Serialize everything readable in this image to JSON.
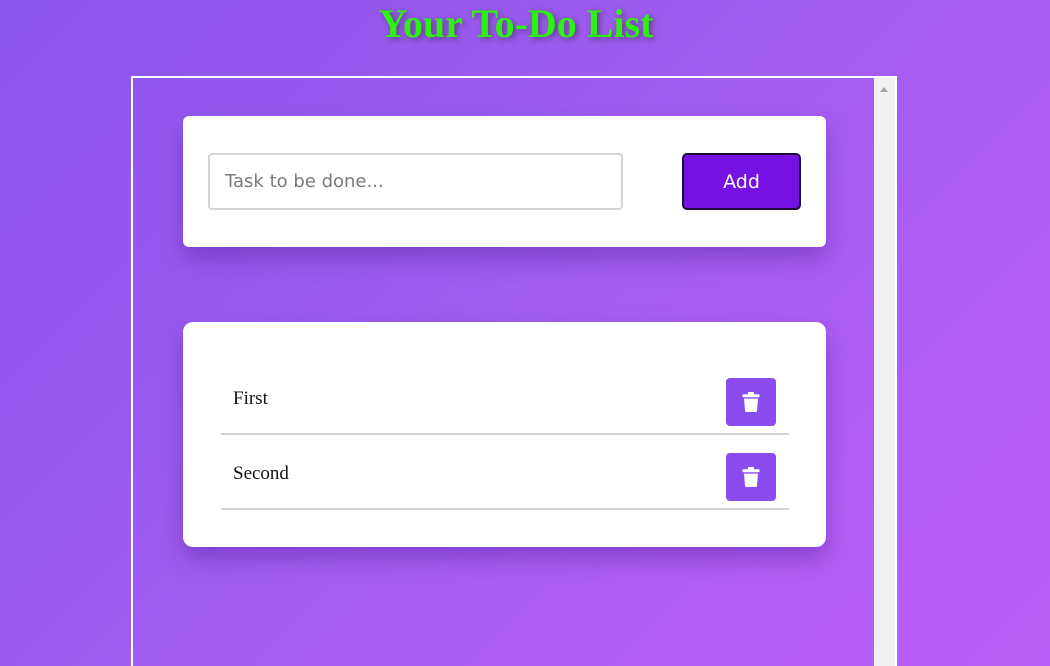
{
  "header": {
    "title": "Your To-Do List"
  },
  "input_form": {
    "placeholder": "Task to be done...",
    "value": "",
    "add_label": "Add"
  },
  "tasks": [
    {
      "text": "First",
      "delete_icon": "trash-icon"
    },
    {
      "text": "Second",
      "delete_icon": "trash-icon"
    }
  ],
  "colors": {
    "title": "#2ef012",
    "add_button": "#7611e3",
    "delete_button": "#8a4bef",
    "background_start": "#8a55ec",
    "background_end": "#bb5ef7"
  }
}
